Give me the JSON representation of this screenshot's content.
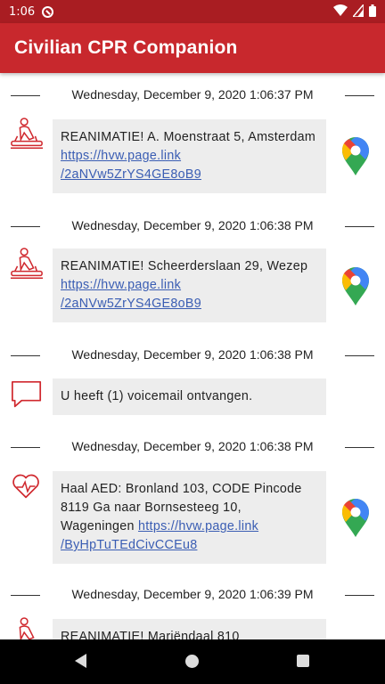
{
  "status_bar": {
    "time": "1:06"
  },
  "app_bar": {
    "title": "Civilian CPR Companion"
  },
  "messages": [
    {
      "date": "Wednesday, December 9, 2020 1:06:37 PM",
      "type": "cpr",
      "text": "REANIMATIE! A. Moenstraat 5, Amsterdam ",
      "link": "https://hvw.page.link/2aNVw5ZrYS4GE8oB9",
      "link_line1": "https://hvw.page.link",
      "link_line2": "/2aNVw5ZrYS4GE8oB9",
      "has_map": true
    },
    {
      "date": "Wednesday, December 9, 2020 1:06:38 PM",
      "type": "cpr",
      "text": "REANIMATIE! Scheerderslaan 29, Wezep ",
      "link": "https://hvw.page.link/2aNVw5ZrYS4GE8oB9",
      "link_line1": "https://hvw.page.link",
      "link_line2": "/2aNVw5ZrYS4GE8oB9",
      "has_map": true
    },
    {
      "date": "Wednesday, December 9, 2020 1:06:38 PM",
      "type": "voicemail",
      "text": "U heeft (1) voicemail ontvangen.",
      "has_map": false
    },
    {
      "date": "Wednesday, December 9, 2020 1:06:38 PM",
      "type": "aed",
      "text": "Haal AED: Bronland 103, CODE Pincode 8119 Ga naar Bornsesteeg 10, Wageningen ",
      "link": "https://hvw.page.link/ByHpTuTEdCivCCEu8",
      "link_line1": "https://hvw.page.link",
      "link_line2": "/ByHpTuTEdCivCCEu8",
      "has_map": true
    },
    {
      "date": "Wednesday, December 9, 2020 1:06:39 PM",
      "type": "cpr",
      "text": "REANIMATIE! Mariëndaal 810",
      "has_map": false
    }
  ],
  "icons": {
    "cpr": "cpr-person-icon",
    "voicemail": "speech-bubble-icon",
    "aed": "heart-pulse-icon",
    "map": "google-maps-pin-icon"
  },
  "colors": {
    "status_bar": "#a91d22",
    "app_bar": "#c8282d",
    "icon_red": "#d0282e",
    "card_bg": "#ededed",
    "link": "#3a5db3"
  }
}
